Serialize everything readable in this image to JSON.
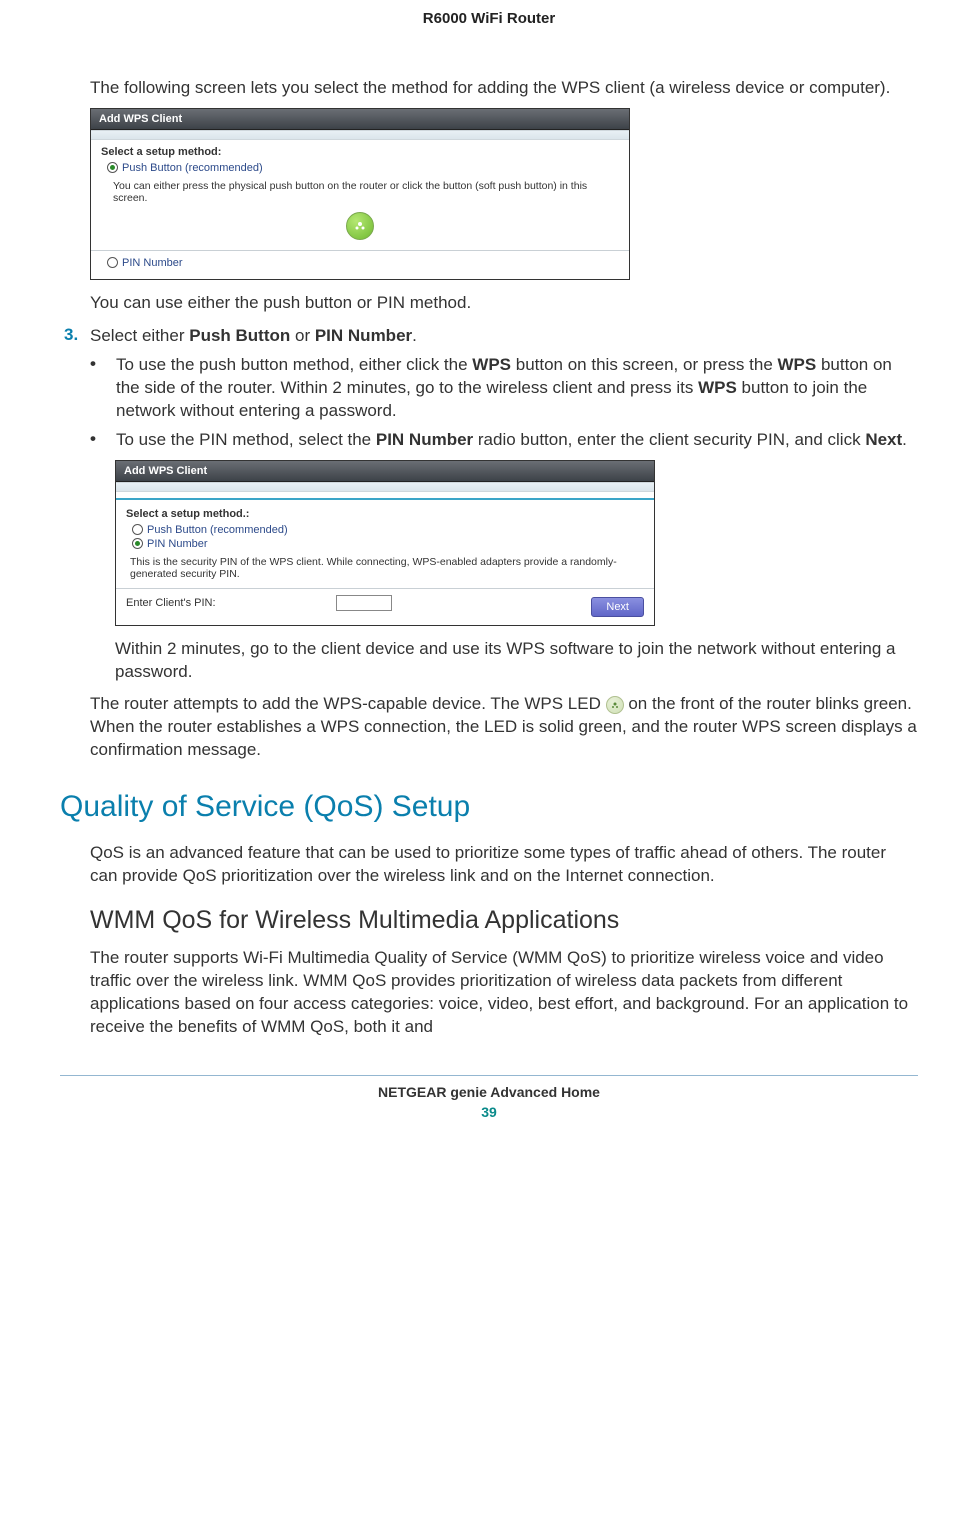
{
  "header": {
    "product": "R6000 WiFi Router"
  },
  "intro": "The following screen lets you select the method for adding the WPS client (a wireless device or computer).",
  "screenshot1": {
    "title": "Add WPS Client",
    "prompt": "Select a setup method:",
    "radio_push": "Push Button (recommended)",
    "radio_pin": "PIN Number",
    "help": "You can either press the physical push button on the router or click the button (soft push button) in this screen."
  },
  "after_sc1": "You can use either the push button or PIN method.",
  "step3": {
    "marker": "3.",
    "lead": "Select either ",
    "b1": "Push Button",
    "mid": " or ",
    "b2": "PIN Number",
    "tail": "."
  },
  "bullet1": {
    "p1": " To use the push button method, either click the ",
    "b1": "WPS",
    "p2": " button on this screen, or press the ",
    "b2": "WPS",
    "p3": " button on the side of the router. Within 2 minutes, go to the wireless client and press its ",
    "b3": "WPS",
    "p4": " button to join the network without entering a password."
  },
  "bullet2": {
    "p1": "To use the PIN method, select the ",
    "b1": "PIN Number",
    "p2": " radio button, enter the client security PIN, and click ",
    "b2": "Next",
    "p3": "."
  },
  "screenshot2": {
    "title": "Add WPS Client",
    "prompt": "Select a setup method.:",
    "radio_push": "Push Button (recommended)",
    "radio_pin": "PIN Number",
    "help": "This is the security PIN of the WPS client. While connecting, WPS-enabled adapters provide a randomly-generated security PIN.",
    "pin_label": "Enter Client's PIN:",
    "next": "Next"
  },
  "after_sc2": "Within 2 minutes, go to the client device and use its WPS software to join the network without entering a password.",
  "para_led": {
    "p1": "The router attempts to add the WPS-capable device. The WPS LED ",
    "p2": " on the front of the router blinks green. When the router establishes a WPS connection, the LED is solid green, and the router WPS screen displays a confirmation message."
  },
  "h1": "Quality of Service (QoS) Setup",
  "qos_intro": "QoS is an advanced feature that can be used to prioritize some types of traffic ahead of others. The router can provide QoS prioritization over the wireless link and on the Internet connection.",
  "h2": "WMM QoS for Wireless Multimedia Applications",
  "wmm_para": "The router supports Wi-Fi Multimedia Quality of Service (WMM QoS) to prioritize wireless voice and video traffic over the wireless link. WMM QoS provides prioritization of wireless data packets from different applications based on four access categories: voice, video, best effort, and background. For an application to receive the benefits of WMM QoS, both it and",
  "footer": {
    "section": "NETGEAR genie Advanced Home",
    "page": "39"
  }
}
